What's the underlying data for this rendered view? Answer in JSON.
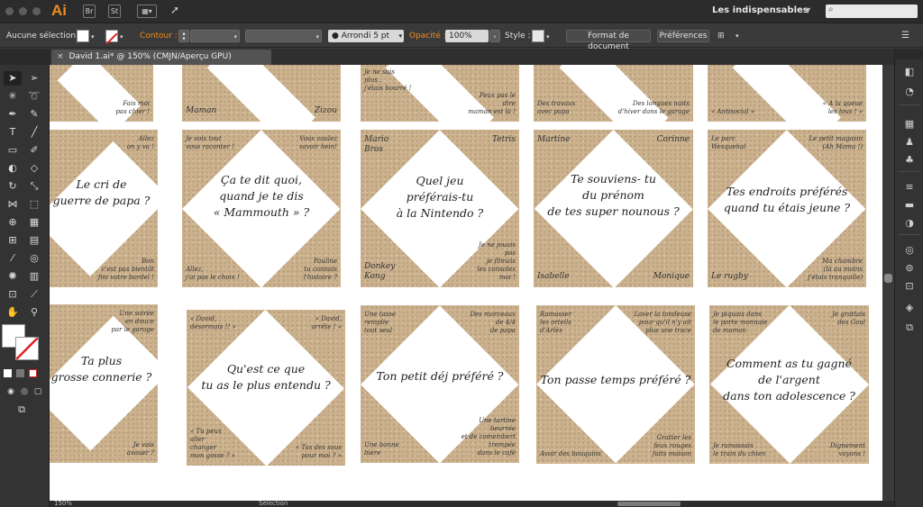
{
  "app": {
    "logo": "Ai",
    "bridge_label": "Br",
    "stock_label": "St",
    "workspace": "Les indispensables",
    "search_placeholder": ""
  },
  "control_bar": {
    "selection_label": "Aucune sélection",
    "stroke_label": "Contour :",
    "brush_label": "Arrondi 5 pt",
    "opacity_label": "Opacité :",
    "opacity_value": "100%",
    "style_label": "Style :",
    "doc_format_button": "Format de document",
    "preferences_button": "Préférences"
  },
  "tab": {
    "title": "David 1.ai* @ 150% (CMJN/Aperçu GPU)",
    "close": "×"
  },
  "status": {
    "zoom": "150%",
    "mode": "Sélection"
  },
  "cards": [
    {
      "q": "",
      "corners": {
        "tl": "",
        "tr": "",
        "bl": "",
        "br": "Fais moi\npas chier !"
      }
    },
    {
      "q": "",
      "corners": {
        "tl": "",
        "tr": "",
        "bl": "Maman",
        "br": "Zizou"
      }
    },
    {
      "q": "",
      "corners": {
        "tl": "Je ne suis\nplus..\nj'étais bourré !",
        "tr": "",
        "bl": "",
        "br": "Peux pas le\ndire\nmaman est là !"
      }
    },
    {
      "q": "",
      "corners": {
        "tl": "",
        "tr": "",
        "bl": "Des travaux\navec papa",
        "br": "Des longues nuits\nd'hiver dans le garage"
      }
    },
    {
      "q": "",
      "corners": {
        "tl": "",
        "tr": "",
        "bl": "« Antisocial »",
        "br": "« A la queue\nles lous ! »"
      }
    },
    {
      "q": "Le cri de\nguerre de papa ?",
      "corners": {
        "tl": "",
        "tr": "Allez\non y va !",
        "bl": "",
        "br": "Bon\nc'est pas bientôt\nfini votre bordel !"
      }
    },
    {
      "q": "Ça te dit quoi,\nquand je te dis\n« Mammouth » ?",
      "corners": {
        "tl": "Je vois tout\nvous raconter !",
        "tr": "Vous voulez\nsavoir hein!",
        "bl": "Allez,\nj'ai pas le choix !",
        "br": "Pauline\ntu connais\nl'histoire ?"
      }
    },
    {
      "q": "Quel jeu\npréférais-tu\nà la Nintendo ?",
      "corners": {
        "tl": "Mario\nBros",
        "tr": "Tetris",
        "bl": "Donkey\nKong",
        "br": "Je ne jouais\npas\nje filmais\nles consoles\nmoi !"
      }
    },
    {
      "q": "Te souviens- tu\ndu prénom\nde tes super nounous ?",
      "corners": {
        "tl": "Martine",
        "tr": "Corinne",
        "bl": "Isabelle",
        "br": "Monique"
      }
    },
    {
      "q": "Tes endroits préférés\nquand tu étais jeune ?",
      "corners": {
        "tl": "Le parc\nWesquehal",
        "tr": "Le petit magasin\n(Ah Mama !)",
        "bl": "Le rugby",
        "br": "Ma chambre\n(là au moins\nj'étais tranquille)"
      }
    },
    {
      "q": "Ta plus\ngrosse connerie ?",
      "corners": {
        "tl": "",
        "tr": "Une soirée\nen douce\npar le garage",
        "bl": "",
        "br": "Je vais\navouer ?"
      }
    },
    {
      "q": "Qu'est ce que\ntu as le plus entendu ?",
      "corners": {
        "tl": "« David,\ndésormais !! »",
        "tr": "« David,\narrête ! »",
        "bl": "« Tu peux\naller\nchanger\nmon gosse ? »",
        "br": "« Tas des sous\npour moi ? »"
      }
    },
    {
      "q": "Ton petit déj préféré ?",
      "corners": {
        "tl": "Une tasse\nremplie\ntout seul",
        "tr": "Des morceaux\nde 4/4\nde papa",
        "bl": "Une bonne\nbière",
        "br": "Une tartine\nbeurrée\net de comembert\ntrempée\ndans le café"
      }
    },
    {
      "q": "Ton passe temps préféré ?",
      "corners": {
        "tl": "Ramasser\nles orteils\nd'Arlès",
        "tr": "Laver la tondeuse\npour qu'il n'y ait\nplus une trace",
        "bl": "Avoir des bouquins",
        "br": "Gratter les\nfeux rouges\nfaits maison"
      }
    },
    {
      "q": "Comment as tu gagné\nde l'argent\ndans ton adolescence ?",
      "corners": {
        "tl": "Je piquais dans\nle porte monnaie\nde maman",
        "tr": "Je grattais\ndes Goal",
        "bl": "Je ramassais\nle train du chien",
        "br": "Dignement\nvoyons !"
      }
    }
  ]
}
